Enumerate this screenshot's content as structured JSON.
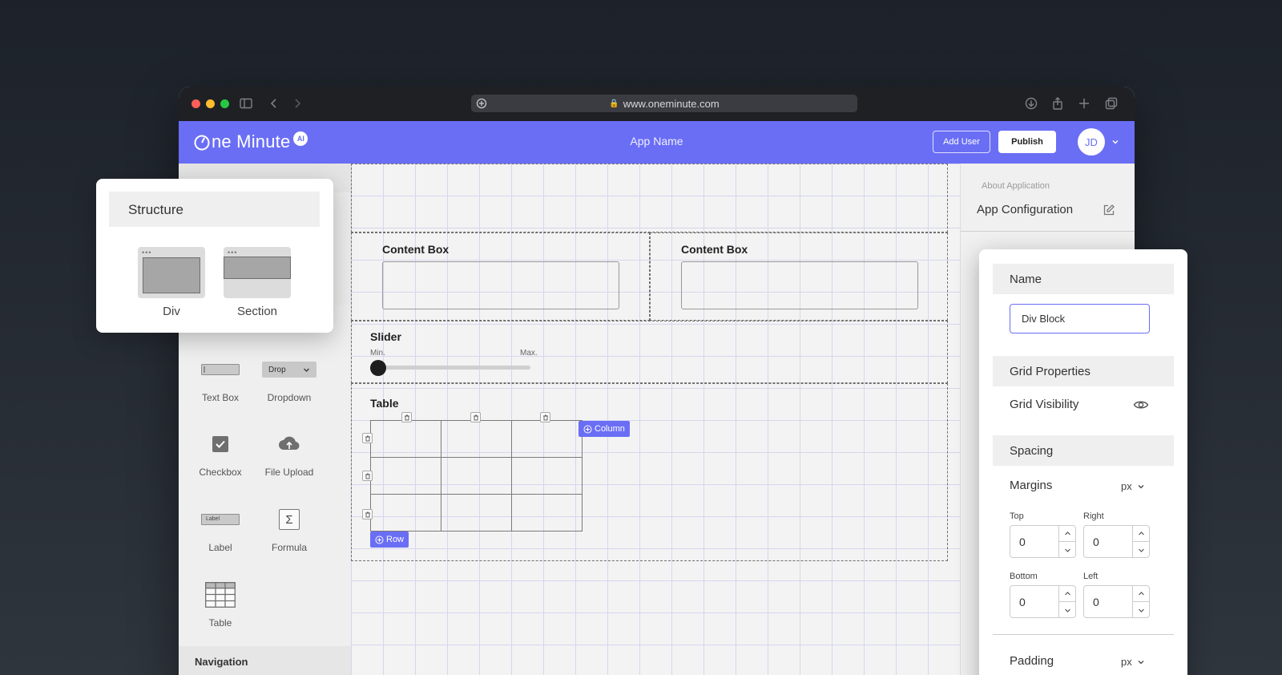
{
  "browser": {
    "url": "www.oneminute.com",
    "icons": [
      "sidebar-icon",
      "back-icon",
      "forward-icon",
      "download-icon",
      "share-icon",
      "new-tab-icon",
      "tabs-icon"
    ]
  },
  "header": {
    "logo_text": "ne Minute",
    "logo_badge": "AI",
    "app_name": "App Name",
    "add_user_label": "Add User",
    "publish_label": "Publish",
    "avatar_initials": "JD",
    "accent_color": "#6a6ef5"
  },
  "structure_card": {
    "title": "Structure",
    "items": [
      {
        "label": "Div"
      },
      {
        "label": "Section"
      }
    ]
  },
  "sidebar": {
    "elements": [
      {
        "label": "Text Box",
        "icon": "textbox-icon"
      },
      {
        "label": "Dropdown",
        "icon": "dropdown-icon",
        "icon_text": "Drop"
      },
      {
        "label": "Checkbox",
        "icon": "checkbox-icon"
      },
      {
        "label": "File Upload",
        "icon": "cloud-upload-icon"
      },
      {
        "label": "Label",
        "icon": "label-icon",
        "icon_text": "Label"
      },
      {
        "label": "Formula",
        "icon": "sigma-icon",
        "icon_text": "Σ"
      },
      {
        "label": "Table",
        "icon": "table-icon"
      }
    ],
    "navigation_label": "Navigation"
  },
  "canvas": {
    "content_box_1_title": "Content Box",
    "content_box_2_title": "Content Box",
    "slider_title": "Slider",
    "slider_min_label": "Min.",
    "slider_max_label": "Max.",
    "slider_value_fraction": 0,
    "table_title": "Table",
    "table_rows": 3,
    "table_columns": 3,
    "add_column_label": "Column",
    "add_row_label": "Row"
  },
  "right_panel": {
    "about_label": "About Application",
    "config_label": "App Configuration"
  },
  "properties": {
    "name_heading": "Name",
    "name_value": "Div Block",
    "grid_heading": "Grid Properties",
    "grid_visibility_label": "Grid Visibility",
    "spacing_heading": "Spacing",
    "margins_label": "Margins",
    "margins_unit": "px",
    "top_label": "Top",
    "top_value": "0",
    "right_label": "Right",
    "right_value": "0",
    "bottom_label": "Bottom",
    "bottom_value": "0",
    "left_label": "Left",
    "left_value": "0",
    "padding_label": "Padding",
    "padding_unit": "px"
  }
}
